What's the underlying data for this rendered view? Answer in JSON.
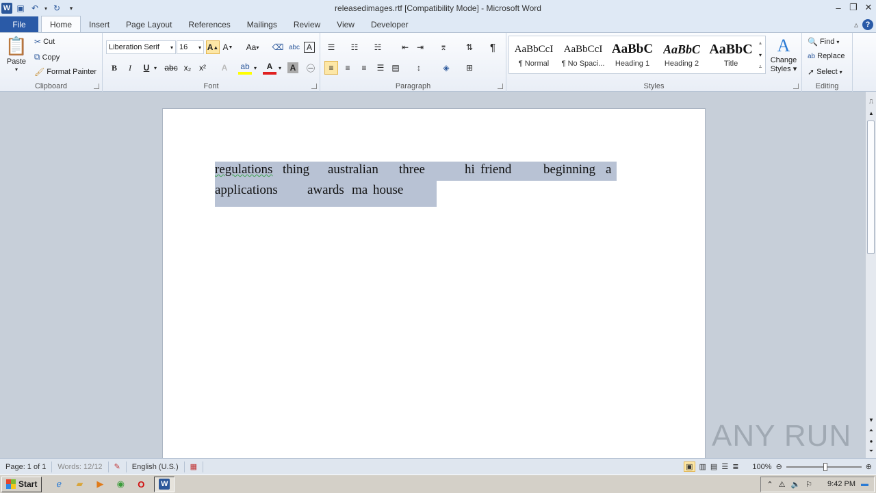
{
  "window": {
    "title": "releasedimages.rtf [Compatibility Mode]  -  Microsoft Word",
    "app_icon": "W"
  },
  "tabs": [
    {
      "label": "File"
    },
    {
      "label": "Home"
    },
    {
      "label": "Insert"
    },
    {
      "label": "Page Layout"
    },
    {
      "label": "References"
    },
    {
      "label": "Mailings"
    },
    {
      "label": "Review"
    },
    {
      "label": "View"
    },
    {
      "label": "Developer"
    }
  ],
  "clipboard": {
    "paste": "Paste",
    "cut": "Cut",
    "copy": "Copy",
    "format_painter": "Format Painter",
    "group_label": "Clipboard"
  },
  "font": {
    "family": "Liberation Serif",
    "size": "16",
    "group_label": "Font",
    "bold": "B",
    "italic": "I",
    "underline": "U",
    "strike": "abc",
    "subscript": "x₂",
    "superscript": "x²",
    "change_case": "Aa"
  },
  "paragraph": {
    "group_label": "Paragraph",
    "show_marks": "¶"
  },
  "styles": {
    "group_label": "Styles",
    "items": [
      {
        "sample": "AaBbCcI",
        "name": "¶ Normal"
      },
      {
        "sample": "AaBbCcI",
        "name": "¶ No Spaci..."
      },
      {
        "sample": "AaBbC",
        "name": "Heading 1"
      },
      {
        "sample": "AaBbC",
        "name": "Heading 2"
      },
      {
        "sample": "AaBbC",
        "name": "Title"
      }
    ],
    "change_styles_line1": "Change",
    "change_styles_line2": "Styles"
  },
  "editing": {
    "group_label": "Editing",
    "find": "Find",
    "replace": "Replace",
    "select": "Select"
  },
  "document": {
    "line1": [
      "regulations",
      "thing",
      "australian",
      "three",
      "hi",
      "friend",
      "beginning",
      "a"
    ],
    "line2": [
      "applications",
      "awards",
      "ma",
      "house"
    ]
  },
  "statusbar": {
    "page": "Page: 1 of 1",
    "words": "Words: 12/12",
    "language": "English (U.S.)",
    "zoom": "100%"
  },
  "taskbar": {
    "start": "Start",
    "clock": "9:42 PM"
  },
  "watermark": "ANY RUN",
  "colors": {
    "accent": "#2a5aa7",
    "selection": "#b8c2d4",
    "ribbon_bg": "#f3f6fb"
  }
}
